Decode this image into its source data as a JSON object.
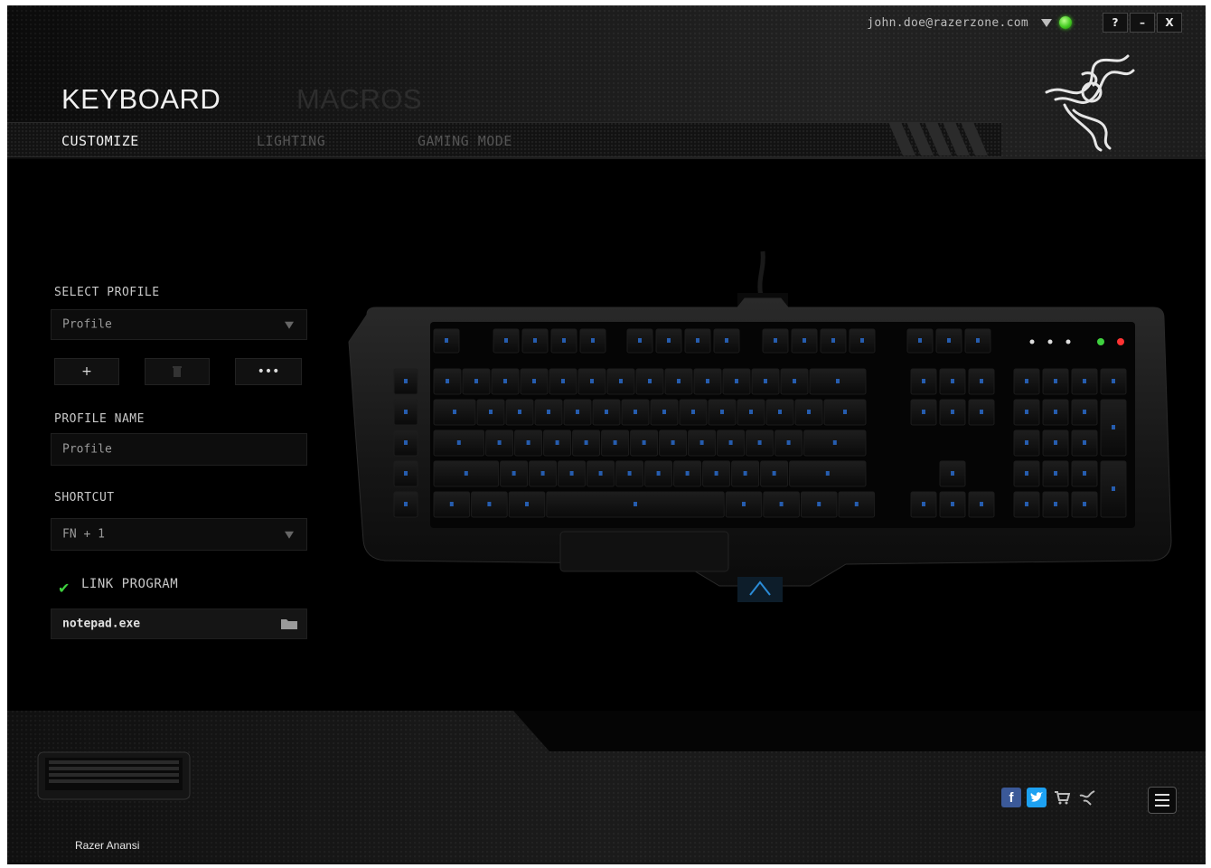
{
  "account": {
    "email": "john.doe@razerzone.com"
  },
  "window_controls": {
    "help": "?",
    "minimize": "–",
    "close": "X"
  },
  "nav": {
    "title": "KEYBOARD",
    "macros": "MACROS"
  },
  "tabs": [
    {
      "label": "CUSTOMIZE",
      "active": true
    },
    {
      "label": "LIGHTING",
      "active": false
    },
    {
      "label": "GAMING MODE",
      "active": false
    }
  ],
  "profile": {
    "select_label": "SELECT PROFILE",
    "select_value": "Profile",
    "add_label": "+",
    "more_label": "•••",
    "name_label": "PROFILE NAME",
    "name_value": "Profile",
    "shortcut_label": "SHORTCUT",
    "shortcut_value": "FN + 1",
    "link_label": "LINK PROGRAM",
    "link_checked": true,
    "program_value": "notepad.exe"
  },
  "device": {
    "name": "Razer Anansi"
  },
  "icons": {
    "status": "status-online-icon",
    "logo": "razer-logo-icon",
    "folder": "folder-icon",
    "facebook": "facebook-icon",
    "twitter": "twitter-icon",
    "store": "cart-icon",
    "razer": "razer-small-icon",
    "menu": "hamburger-menu-icon"
  },
  "colors": {
    "accent": "#3fd13f",
    "key_legend": "#2a6fd6",
    "facebook": "#3b5998",
    "twitter": "#1da1f2"
  }
}
